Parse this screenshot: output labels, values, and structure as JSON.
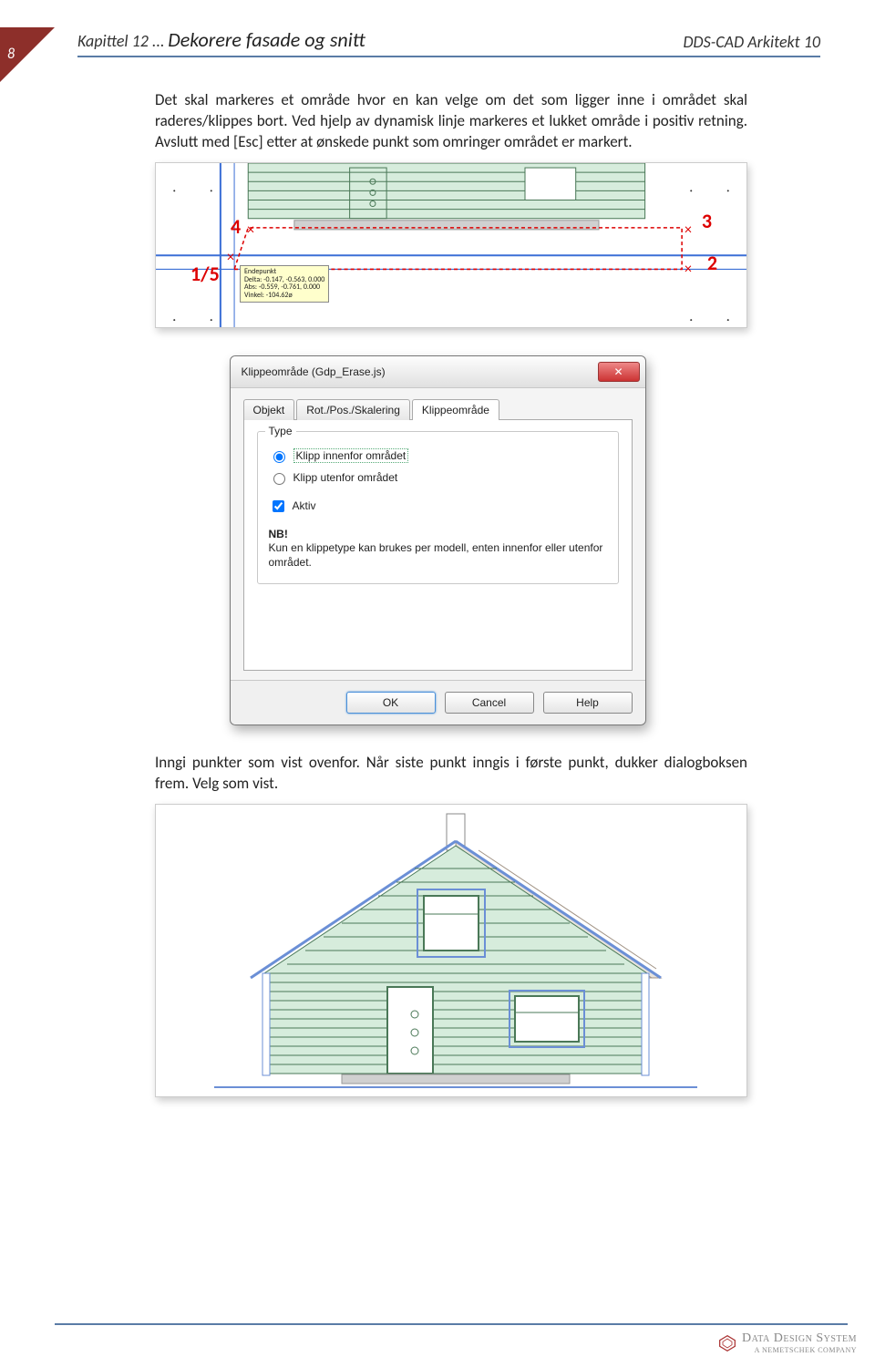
{
  "page_number": "8",
  "header": {
    "chapter_prefix": "Kapittel 12 ...",
    "chapter_title": "Dekorere fasade og snitt",
    "product": "DDS-CAD Arkitekt 10"
  },
  "paragraph1": "Det skal markeres et område hvor en kan velge om det som ligger inne i området skal raderes/klippes bort. Ved hjelp av dynamisk linje markeres et lukket område i positiv retning. Avslutt med [Esc] etter at ønskede punkt som omringer området er markert.",
  "figure1": {
    "labels": {
      "p1": "1/5",
      "p2": "2",
      "p3": "3",
      "p4": "4"
    },
    "tooltip": {
      "title": "Endepunkt",
      "line1": "Delta: -0.147, -0.563, 0.000",
      "line2": "Abs: -0.559, -0.761, 0.000",
      "line3": "Vinkel: -104.62ø"
    }
  },
  "dialog": {
    "title": "Klippeområde (Gdp_Erase.js)",
    "tabs": [
      "Objekt",
      "Rot./Pos./Skalering",
      "Klippeområde"
    ],
    "active_tab": 2,
    "group_title": "Type",
    "radio1": "Klipp innenfor området",
    "radio2": "Klipp utenfor området",
    "checkbox": "Aktiv",
    "note_label": "NB!",
    "note_text": "Kun en klippetype kan brukes per modell, enten innenfor eller utenfor området.",
    "buttons": {
      "ok": "OK",
      "cancel": "Cancel",
      "help": "Help"
    }
  },
  "paragraph2": "Inngi punkter som vist ovenfor. Når siste punkt inngis i første punkt, dukker dialogboksen frem. Velg som vist.",
  "footer": {
    "company": "Data Design System",
    "tagline": "A NEMETSCHEK COMPANY"
  }
}
